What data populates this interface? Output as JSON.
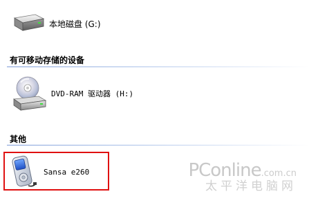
{
  "sections": {
    "hard_disks": {
      "items": [
        {
          "label": "本地磁盘 (G:)",
          "icon": "hard-drive-icon"
        }
      ]
    },
    "removable": {
      "header": "有可移动存储的设备",
      "items": [
        {
          "label": "DVD-RAM 驱动器 (H:)",
          "icon": "dvd-drive-icon"
        }
      ]
    },
    "other": {
      "header": "其他",
      "items": [
        {
          "label": "Sansa e260",
          "icon": "mp3-player-icon"
        }
      ]
    }
  },
  "highlight": {
    "color": "#e01010"
  },
  "watermark": {
    "brand": "PConline",
    "domain": ".com.cn",
    "subtitle": "太平洋电脑网"
  },
  "colors": {
    "group_line": "#7d9bd8",
    "highlight": "#e01010"
  }
}
